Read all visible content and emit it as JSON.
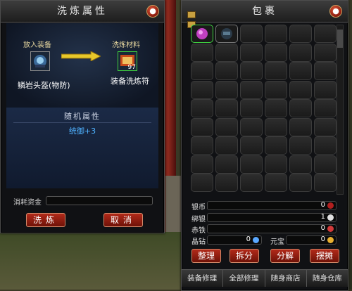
{
  "forge": {
    "title": "洗炼属性",
    "equip_slot_label": "放入装备",
    "equip_name": "鳞岩头盔(物防)",
    "material_slot_label": "洗炼材料",
    "material_count": "97",
    "material_name": "装备洗炼符",
    "random_attr_header": "随机属性",
    "random_attr_value": "统御+3",
    "cost_label": "消耗资金",
    "refine_button": "洗炼",
    "cancel_button": "取消",
    "close_icon": "close-icon"
  },
  "bag": {
    "title": "包裹",
    "close_icon": "close-icon",
    "filled_items": [
      "purple-gem-icon",
      "dark-helmet-icon"
    ],
    "currencies": [
      {
        "label": "银币",
        "value": "0",
        "icon": "silver-coin-icon",
        "color": "#b21f1f"
      },
      {
        "label": "绑银",
        "value": "1",
        "icon": "bound-silver-icon",
        "color": "#e0e0e0"
      },
      {
        "label": "赤铁",
        "value": "0",
        "icon": "red-iron-icon",
        "color": "#d23a3a"
      },
      {
        "label": "晶钻",
        "value": "0",
        "icon": "crystal-icon",
        "color": "#5aa8ff"
      },
      {
        "label": "元宝",
        "value": "0",
        "icon": "ingot-icon",
        "color": "#e8b030"
      }
    ],
    "buttons": [
      "整理",
      "拆分",
      "分解",
      "摆摊"
    ],
    "tabs": [
      "装备修理",
      "全部修理",
      "随身商店",
      "随身仓库"
    ]
  },
  "colors": {
    "accent_red": "#b22a1a",
    "attr_blue": "#4fb2ff",
    "label_gold": "#e8d8a0"
  }
}
